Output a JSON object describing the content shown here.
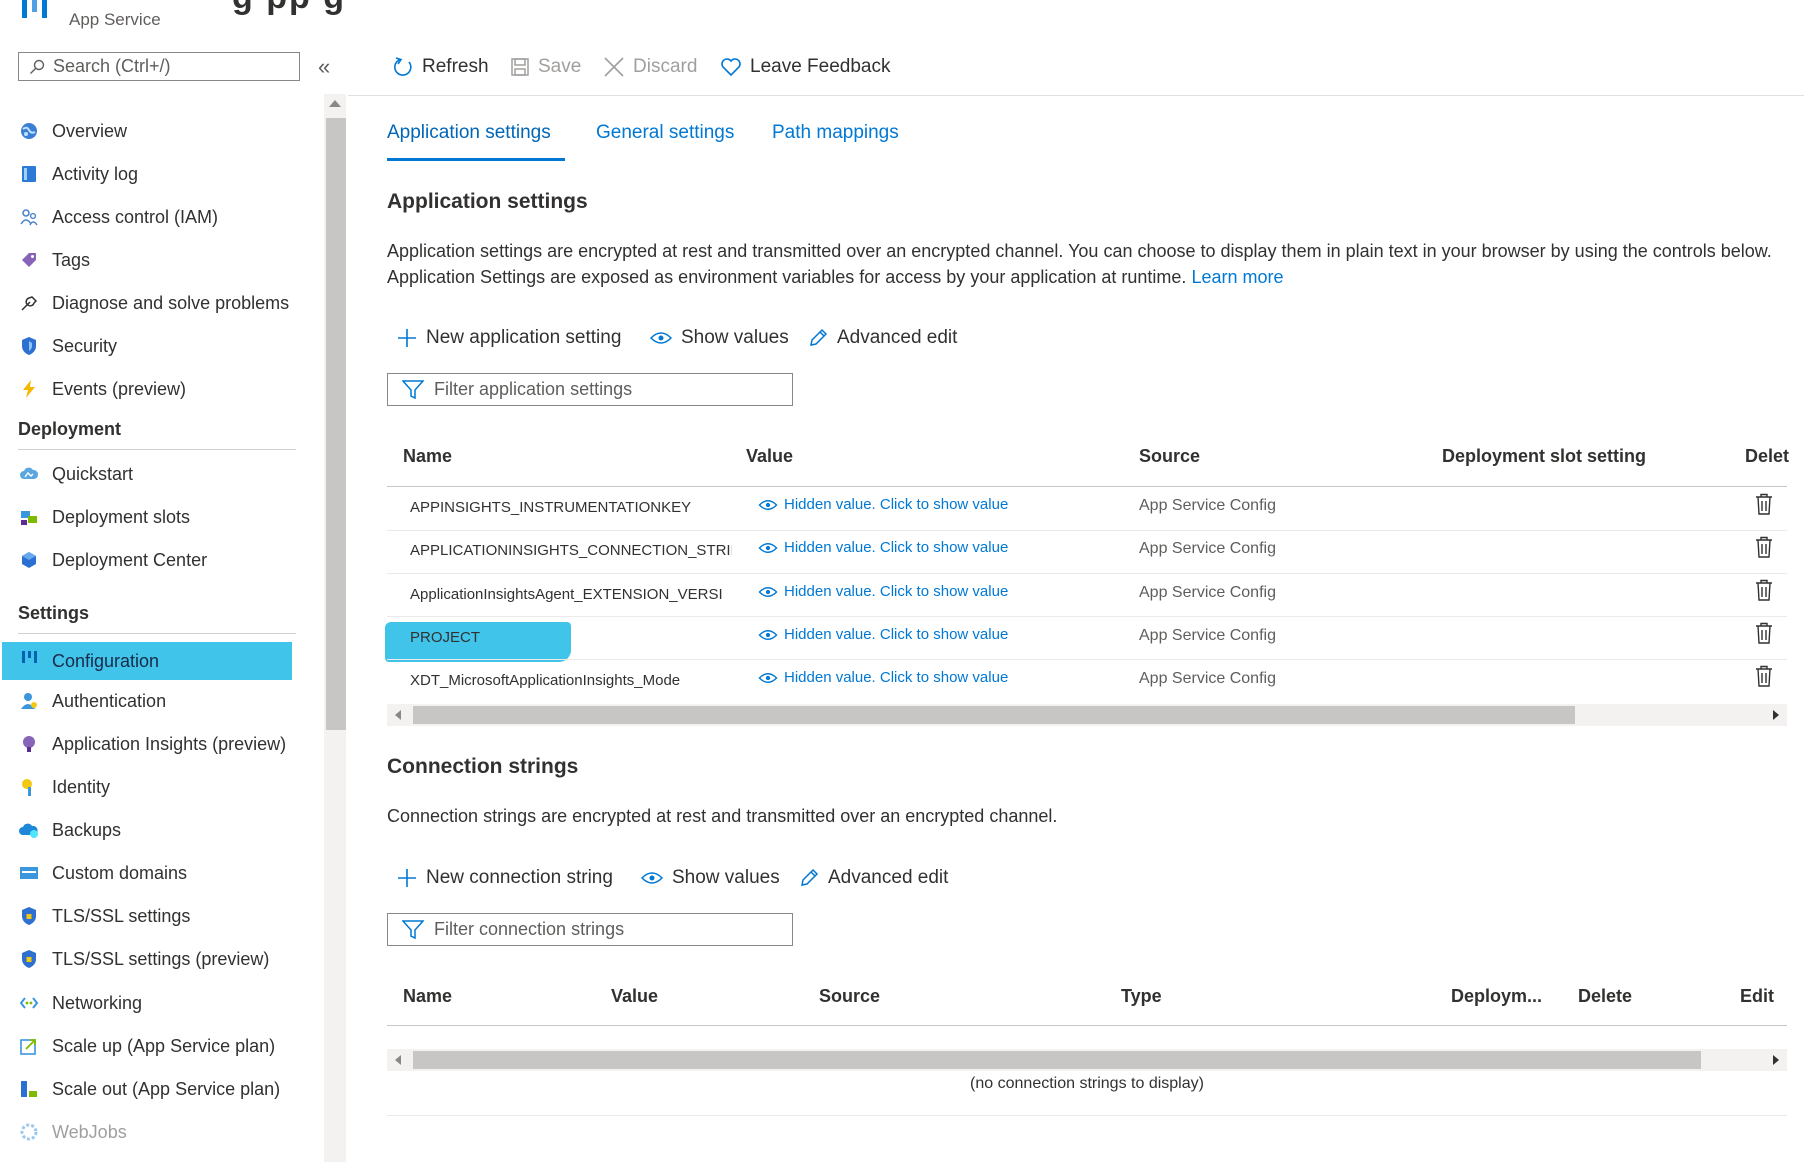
{
  "header": {
    "subtitle": "App Service",
    "title_fragment": "g pp  g"
  },
  "sidebar": {
    "search_placeholder": "Search (Ctrl+/)",
    "collapse_glyph": "«",
    "items": [
      {
        "label": "Overview",
        "icon": "globe-icon"
      },
      {
        "label": "Activity log",
        "icon": "activity-log-icon"
      },
      {
        "label": "Access control (IAM)",
        "icon": "people-icon"
      },
      {
        "label": "Tags",
        "icon": "tag-icon"
      },
      {
        "label": "Diagnose and solve problems",
        "icon": "wrench-icon"
      },
      {
        "label": "Security",
        "icon": "shield-icon"
      },
      {
        "label": "Events (preview)",
        "icon": "lightning-icon"
      }
    ],
    "sections": [
      {
        "title": "Deployment"
      },
      {
        "title": "Settings"
      }
    ],
    "deployment_items": [
      {
        "label": "Quickstart",
        "icon": "cloud-icon"
      },
      {
        "label": "Deployment slots",
        "icon": "slots-icon"
      },
      {
        "label": "Deployment Center",
        "icon": "cube-icon"
      }
    ],
    "settings_items": [
      {
        "label": "Configuration",
        "icon": "config-icon",
        "selected": true
      },
      {
        "label": "Authentication",
        "icon": "user-icon"
      },
      {
        "label": "Application Insights (preview)",
        "icon": "bulb-icon"
      },
      {
        "label": "Identity",
        "icon": "key-icon"
      },
      {
        "label": "Backups",
        "icon": "cloud-backup-icon"
      },
      {
        "label": "Custom domains",
        "icon": "domain-icon"
      },
      {
        "label": "TLS/SSL settings",
        "icon": "shield-icon"
      },
      {
        "label": "TLS/SSL settings (preview)",
        "icon": "shield-icon"
      },
      {
        "label": "Networking",
        "icon": "network-icon"
      },
      {
        "label": "Scale up (App Service plan)",
        "icon": "scale-up-icon"
      },
      {
        "label": "Scale out (App Service plan)",
        "icon": "scale-out-icon"
      },
      {
        "label": "WebJobs",
        "icon": "webjobs-icon",
        "dim": true
      }
    ]
  },
  "toolbar": {
    "refresh": "Refresh",
    "save": "Save",
    "discard": "Discard",
    "feedback": "Leave Feedback"
  },
  "tabs": [
    {
      "label": "Application settings",
      "active": true
    },
    {
      "label": "General settings"
    },
    {
      "label": "Path mappings"
    }
  ],
  "app_settings": {
    "title": "Application settings",
    "description": "Application settings are encrypted at rest and transmitted over an encrypted channel. You can choose to display them in plain text in your browser by using the controls below. Application Settings are exposed as environment variables for access by your application at runtime.",
    "learn_more": "Learn more",
    "new_label": "New application setting",
    "show_values": "Show values",
    "advanced_edit": "Advanced edit",
    "filter_placeholder": "Filter application settings",
    "columns": {
      "name": "Name",
      "value": "Value",
      "source": "Source",
      "slot": "Deployment slot setting",
      "delete": "Delet"
    },
    "rows": [
      {
        "name": "APPINSIGHTS_INSTRUMENTATIONKEY",
        "value": "Hidden value. Click to show value",
        "source": "App Service Config"
      },
      {
        "name": "APPLICATIONINSIGHTS_CONNECTION_STRIN",
        "value": "Hidden value. Click to show value",
        "source": "App Service Config"
      },
      {
        "name": "ApplicationInsightsAgent_EXTENSION_VERSI",
        "value": "Hidden value. Click to show value",
        "source": "App Service Config"
      },
      {
        "name": "PROJECT",
        "value": "Hidden value. Click to show value",
        "source": "App Service Config",
        "highlighted": true
      },
      {
        "name": "XDT_MicrosoftApplicationInsights_Mode",
        "value": "Hidden value. Click to show value",
        "source": "App Service Config"
      }
    ]
  },
  "conn_strings": {
    "title": "Connection strings",
    "description": "Connection strings are encrypted at rest and transmitted over an encrypted channel.",
    "new_label": "New connection string",
    "show_values": "Show values",
    "advanced_edit": "Advanced edit",
    "filter_placeholder": "Filter connection strings",
    "columns": {
      "name": "Name",
      "value": "Value",
      "source": "Source",
      "type": "Type",
      "slot": "Deploym...",
      "delete": "Delete",
      "edit": "Edit"
    },
    "empty": "(no connection strings to display)"
  },
  "colors": {
    "accent": "#0078d4",
    "highlight": "#40c4e9"
  }
}
